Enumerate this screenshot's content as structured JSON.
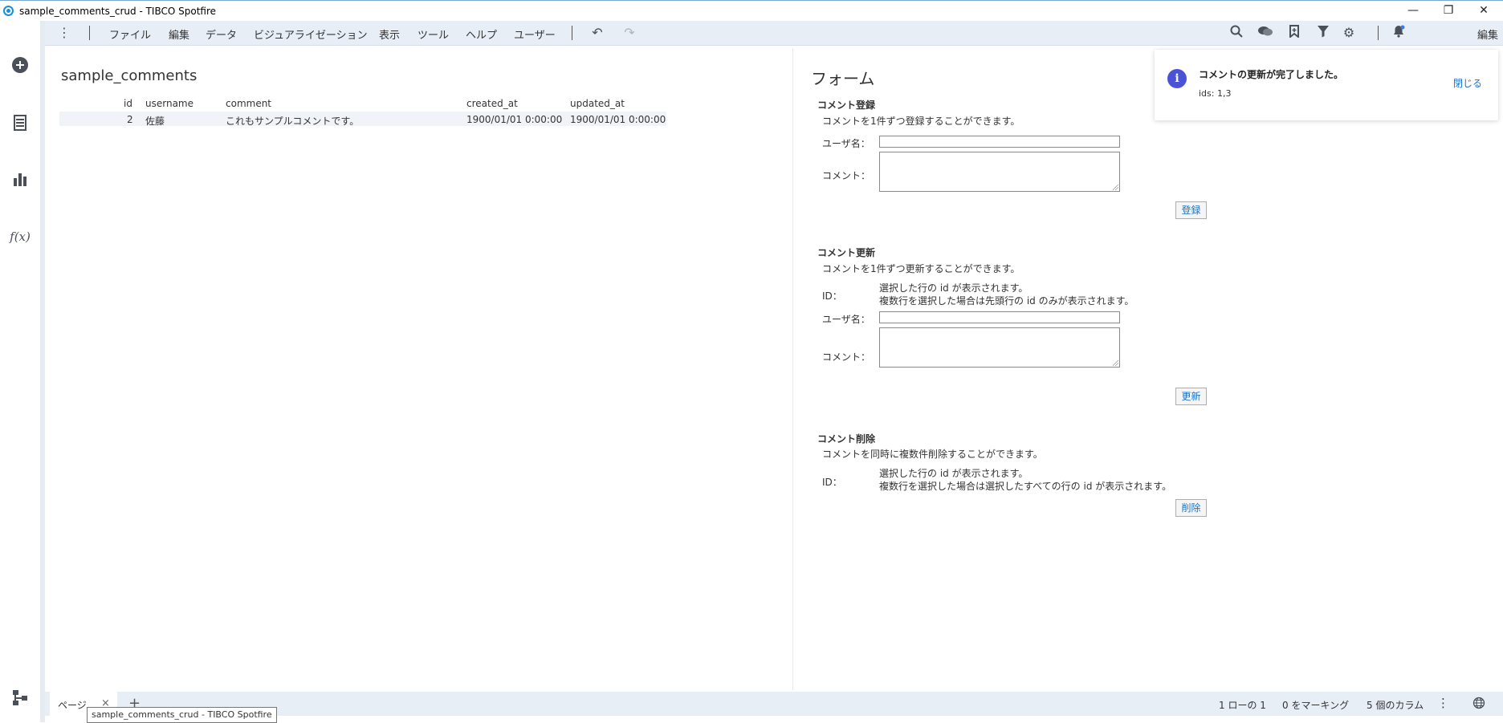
{
  "window": {
    "title": "sample_comments_crud - TIBCO Spotfire",
    "controls": {
      "minimize": "—",
      "restore": "❐",
      "close": "✕"
    }
  },
  "menu": {
    "items": [
      "ファイル",
      "編集",
      "データ",
      "ビジュアライゼーション",
      "表示",
      "ツール",
      "ヘルプ",
      "ユーザー"
    ],
    "mode": "編集"
  },
  "table": {
    "title": "sample_comments",
    "columns": [
      "id",
      "username",
      "comment",
      "created_at",
      "updated_at"
    ],
    "rows": [
      {
        "id": "2",
        "username": "佐藤",
        "comment": "これもサンプルコメントです。",
        "created_at": "1900/01/01 0:00:00",
        "updated_at": "1900/01/01 0:00:00"
      }
    ]
  },
  "form": {
    "title": "フォーム",
    "register": {
      "title": "コメント登録",
      "desc": "コメントを1件ずつ登録することができます。",
      "username_label": "ユーザ名：",
      "comment_label": "コメント：",
      "button": "登録"
    },
    "update": {
      "title": "コメント更新",
      "desc": "コメントを1件ずつ更新することができます。",
      "id_label": "ID：",
      "id_hint1": "選択した行の id が表示されます。",
      "id_hint2": "複数行を選択した場合は先頭行の id のみが表示されます。",
      "username_label": "ユーザ名：",
      "comment_label": "コメント：",
      "button": "更新"
    },
    "delete": {
      "title": "コメント削除",
      "desc": "コメントを同時に複数件削除することができます。",
      "id_label": "ID：",
      "id_hint1": "選択した行の id が表示されます。",
      "id_hint2": "複数行を選択した場合は選択したすべての行の id が表示されます。",
      "button": "削除"
    }
  },
  "notification": {
    "message": "コメントの更新が完了しました。",
    "detail": "ids: 1,3",
    "close": "閉じる"
  },
  "bottom": {
    "page_tab": "ページ",
    "tab_close": "×",
    "add_page": "+",
    "rows": "1 ローの 1",
    "marking": "0 をマーキング",
    "columns": "5 個のカラム",
    "tooltip": "sample_comments_crud - TIBCO Spotfire"
  }
}
